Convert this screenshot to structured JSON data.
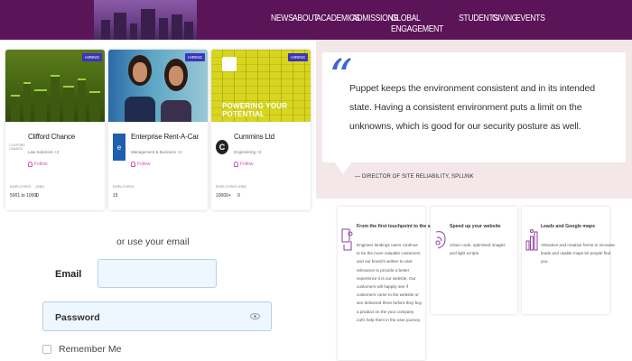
{
  "nav": {
    "items": [
      "NEWS",
      "ABOUT",
      "ACADEMICS",
      "ADMISSIONS",
      "GLOBAL ENGAGEMENT",
      "STUDENTS",
      "GIVING",
      "EVENTS"
    ]
  },
  "cards": [
    {
      "tag": "HIRING",
      "name": "Clifford Chance",
      "logo_text": "CLIFFORD CHANCE",
      "category": "Law Solicitors +2",
      "follow": "Follow",
      "stat1_label": "EMPLOYEES",
      "stat1_value": "5001 to 10000",
      "stat2_label": "JOBS",
      "stat2_value": "1"
    },
    {
      "tag": "HIRING",
      "name": "Enterprise Rent-A-Car",
      "logo_text": "e",
      "category": "Management & Business +2",
      "follow": "Follow",
      "stat1_label": "EMPLOYEES",
      "stat1_value": "",
      "stat2_label": "JOBS",
      "stat2_value": "15"
    },
    {
      "tag": "HIRING",
      "name": "Cummins Ltd",
      "logo_text": "C",
      "category": "Engineering +3",
      "follow": "Follow",
      "photo_text": "POWERING YOUR POTENTIAL",
      "stat1_label": "EMPLOYEES",
      "stat1_value": "10000+",
      "stat2_label": "JOBS",
      "stat2_value": "9"
    }
  ],
  "login": {
    "or_email": "or use your email",
    "email_label": "Email",
    "password_placeholder": "Password",
    "remember_me": "Remember Me"
  },
  "quote": {
    "mark": "“",
    "text": "Puppet keeps the environment consistent and in its intended state. Having a consistent environment puts a limit on the unknowns, which is good for our security posture as well.",
    "attribution": "— DIRECTOR OF SITE RELIABILITY, SPLUNK"
  },
  "features": [
    {
      "title": "From the first touchpoint to the sale",
      "desc": "Engineer landings users continue to be the more valuable customers and our brand's written to user relevance to provide a better experience it is our website. Our customers will happily see if customers come to the website or see delivered three before they buy a product on the your company Ltd's help them in the user journey."
    },
    {
      "title": "Speed up your website",
      "desc": "Clean code, optimised images and light scripts."
    },
    {
      "title": "Leads and Google maps",
      "desc": "Attractive and creative forms to increase leads and usable maps let people find you."
    }
  ],
  "colors": {
    "topbar": "#5c1458",
    "accent_blue": "#3a68cf",
    "follow_pink": "#d44fb6",
    "icon_purple": "#8b3f9e",
    "quote_bg": "#f3e7ea"
  }
}
